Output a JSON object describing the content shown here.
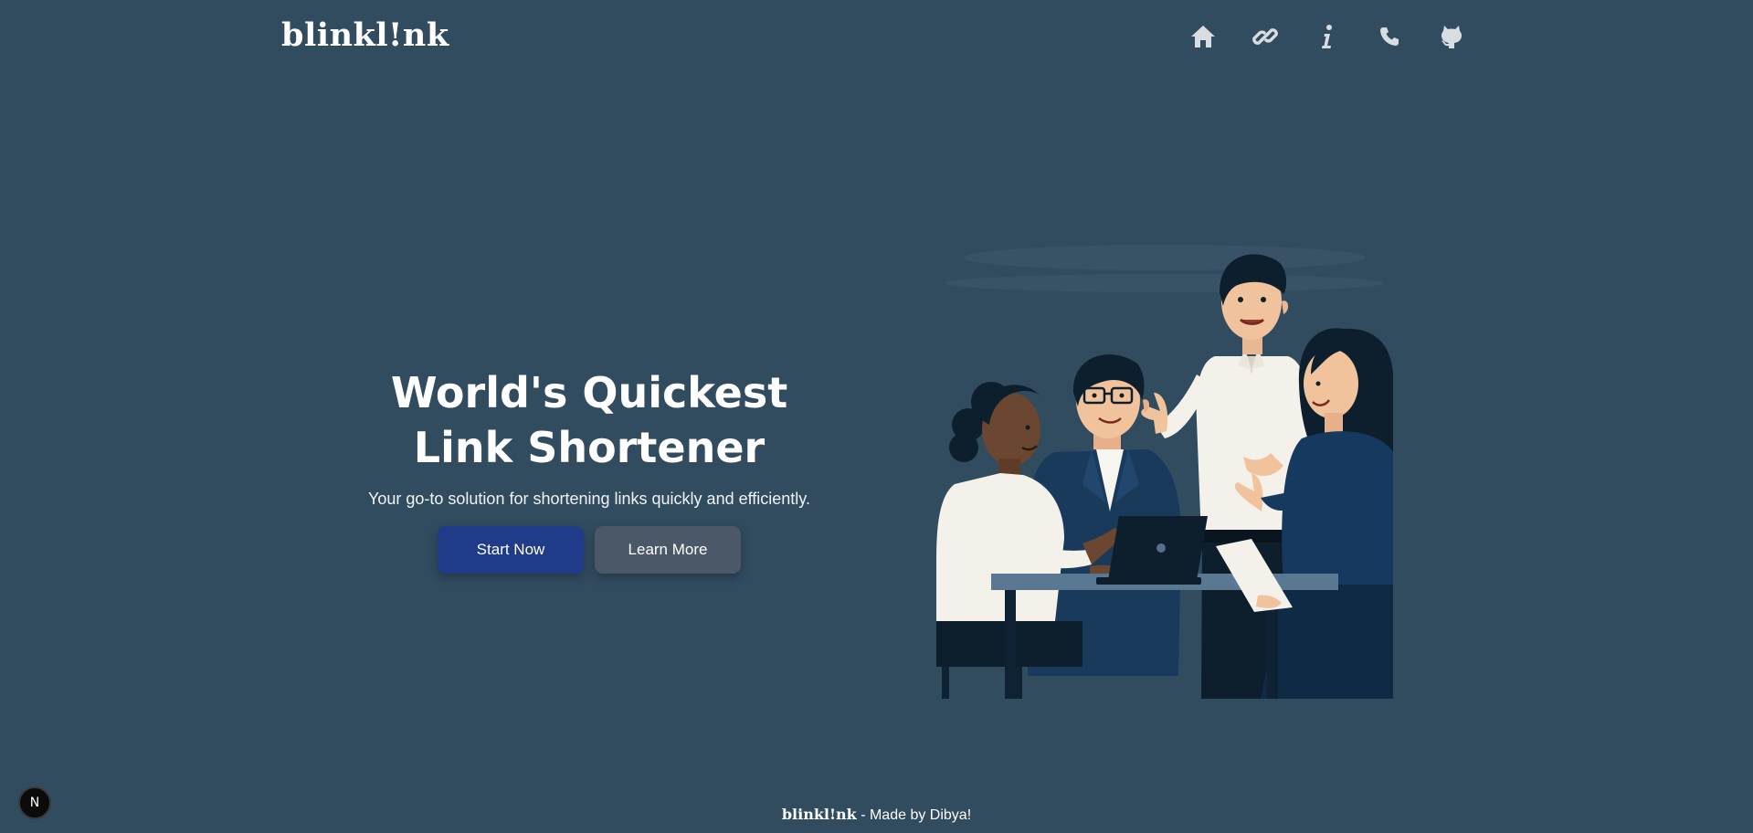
{
  "header": {
    "brand": "blinkl!nk",
    "nav": [
      {
        "icon": "home-icon"
      },
      {
        "icon": "link-icon"
      },
      {
        "icon": "info-icon"
      },
      {
        "icon": "phone-icon"
      },
      {
        "icon": "github-icon"
      }
    ]
  },
  "hero": {
    "title": "World's Quickest Link Shortener",
    "subtitle": "Your go-to solution for shortening links quickly and efficiently.",
    "primary_button": "Start Now",
    "secondary_button": "Learn More"
  },
  "dev_badge": {
    "label": "N"
  },
  "footer": {
    "brand": "blinkl!nk",
    "text": " - Made by Dibya!"
  },
  "colors": {
    "background": "#314b5f",
    "primary_button": "#1f3b8a",
    "secondary_button": "#4b5868",
    "nav_icon": "#d9dde1"
  }
}
